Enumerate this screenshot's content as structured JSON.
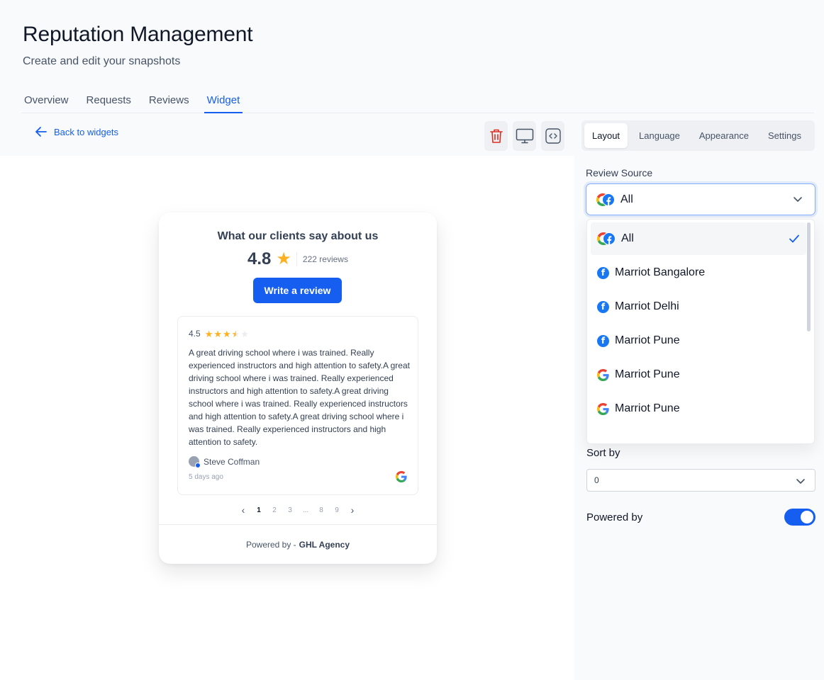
{
  "header": {
    "title": "Reputation Management",
    "subtitle": "Create and edit your snapshots"
  },
  "tabs": [
    {
      "label": "Overview",
      "active": false
    },
    {
      "label": "Requests",
      "active": false
    },
    {
      "label": "Reviews",
      "active": false
    },
    {
      "label": "Widget",
      "active": true
    }
  ],
  "back_link": {
    "label": "Back to widgets",
    "icon": "arrow-left-icon"
  },
  "toolbar": {
    "icons": [
      "trash-icon",
      "monitor-icon",
      "code-icon"
    ],
    "delete_color": "#d92d20"
  },
  "widget": {
    "title": "What our clients say about us",
    "rating": "4.8",
    "review_count": "222 reviews",
    "write_button": "Write a review",
    "review": {
      "rating": "4.5",
      "stars": 4.5,
      "text": "A great driving school where i was trained. Really experienced instructors and high attention to safety.A great driving school where i was trained. Really experienced instructors and high attention to safety.A great driving school where i was trained. Really experienced instructors and high attention to safety.A great driving school where i was trained. Really experienced instructors and high attention to safety.",
      "author": "Steve Coffman",
      "date": "5 days ago",
      "source": "google-icon"
    },
    "pagination": {
      "pages": [
        "1",
        "2",
        "3",
        "...",
        "8",
        "9"
      ],
      "current": "1"
    },
    "footer": {
      "prefix": "Powered by -",
      "brand": "GHL Agency"
    }
  },
  "settings": {
    "tabs": [
      {
        "label": "Layout",
        "active": true
      },
      {
        "label": "Language",
        "active": false
      },
      {
        "label": "Appearance",
        "active": false
      },
      {
        "label": "Settings",
        "active": false
      }
    ],
    "review_source": {
      "label": "Review Source",
      "selected": "All",
      "options": [
        {
          "label": "All",
          "icon": "google-facebook-icon",
          "selected": true
        },
        {
          "label": "Marriot Bangalore",
          "icon": "facebook-icon",
          "selected": false
        },
        {
          "label": "Marriot Delhi",
          "icon": "facebook-icon",
          "selected": false
        },
        {
          "label": "Marriot Pune",
          "icon": "facebook-icon",
          "selected": false
        },
        {
          "label": "Marriot Pune",
          "icon": "google-icon",
          "selected": false
        },
        {
          "label": "Marriot Pune",
          "icon": "google-icon",
          "selected": false
        }
      ]
    },
    "sort_by": {
      "label": "Sort by",
      "value": "0"
    },
    "powered_by": {
      "label": "Powered by",
      "enabled": true
    }
  },
  "colors": {
    "accent": "#155eef",
    "star": "#fdb022",
    "facebook": "#1877f2"
  }
}
